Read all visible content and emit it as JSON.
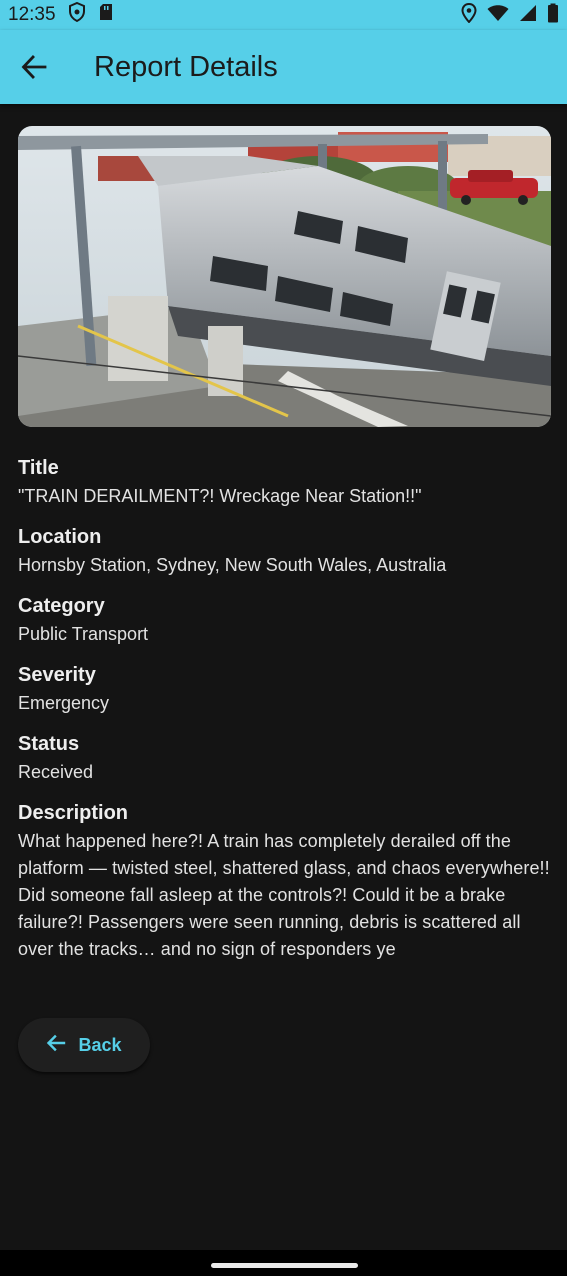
{
  "status_bar": {
    "time": "12:35",
    "icons_left": [
      "shield-icon",
      "sd-card-icon"
    ],
    "icons_right": [
      "location-icon",
      "wifi-icon",
      "signal-icon",
      "battery-icon"
    ]
  },
  "app_bar": {
    "title": "Report Details",
    "back_icon": "arrow-back-icon",
    "color": "#56cfe8"
  },
  "image": {
    "subject": "derailed train near station platform"
  },
  "fields": {
    "title": {
      "label": "Title",
      "value": "\"TRAIN DERAILMENT?! Wreckage Near Station!!\""
    },
    "location": {
      "label": "Location",
      "value": "Hornsby Station, Sydney, New South Wales, Australia"
    },
    "category": {
      "label": "Category",
      "value": "Public Transport"
    },
    "severity": {
      "label": "Severity",
      "value": "Emergency"
    },
    "status": {
      "label": "Status",
      "value": "Received"
    },
    "description": {
      "label": "Description",
      "value": "What happened here?! A train has completely derailed off the platform — twisted steel, shattered glass, and chaos everywhere!!  Did someone fall asleep at the controls?! Could it be a brake failure?!  Passengers were seen running, debris is scattered all over the tracks… and no sign of responders ye"
    }
  },
  "back_button": {
    "label": "Back",
    "icon": "arrow-back-icon",
    "color": "#56cfe8"
  }
}
